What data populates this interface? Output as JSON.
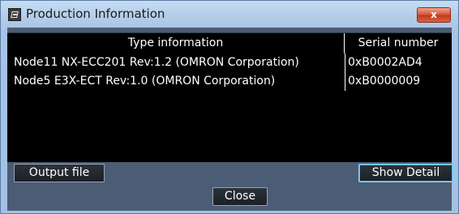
{
  "window": {
    "title": "Production Information",
    "close_glyph": "x"
  },
  "table": {
    "columns": [
      "Type information",
      "Serial number"
    ],
    "rows": [
      {
        "type": "Node11 NX-ECC201 Rev:1.2 (OMRON Corporation)",
        "serial": "0xB0002AD4"
      },
      {
        "type": "Node5 E3X-ECT Rev:1.0 (OMRON Corporation)",
        "serial": "0xB0000009"
      }
    ]
  },
  "buttons": {
    "output_file": "Output file",
    "show_detail": "Show Detail",
    "close": "Close"
  },
  "colors": {
    "titlebar": "#b3cde9",
    "list_background": "#000000",
    "client_background": "#4b5d75",
    "close_button": "#d6583b",
    "focus_border": "#8fd2ff"
  },
  "icons": {
    "app": "app-window-icon",
    "close": "close-icon"
  }
}
